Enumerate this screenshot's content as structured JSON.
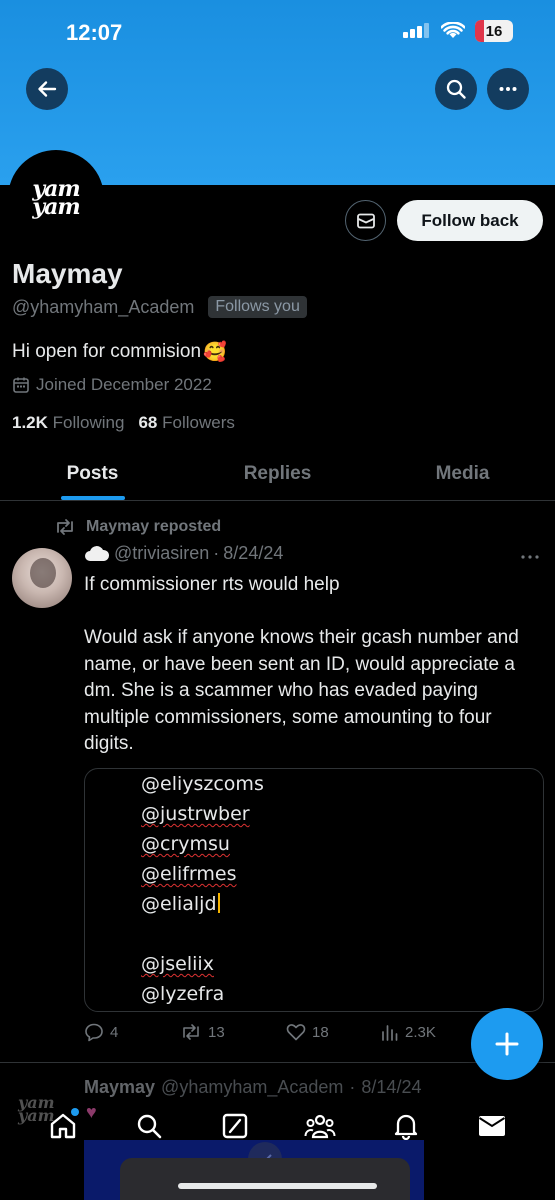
{
  "status_bar": {
    "time": "12:07",
    "battery": "16"
  },
  "profile": {
    "logo_text": "yam yam",
    "message_button_icon": "envelope-icon",
    "follow_label": "Follow back",
    "name": "Maymay",
    "handle": "@yhamyham_Academ",
    "follows_you": "Follows you",
    "bio": "Hi open for commision",
    "bio_emoji": "🥰",
    "joined": "Joined December 2022",
    "following_count": "1.2K",
    "following_label": "Following",
    "followers_count": "68",
    "followers_label": "Followers"
  },
  "tabs": [
    {
      "label": "Posts",
      "active": true
    },
    {
      "label": "Replies",
      "active": false
    },
    {
      "label": "Media",
      "active": false
    }
  ],
  "post": {
    "repost_label": "Maymay reposted",
    "author_handle": "@triviasiren",
    "date": "8/24/24",
    "text": "If commissioner rts would help\n\nWould ask if anyone knows their gcash number and name, or have been sent an ID, would appreciate a dm. She is a scammer who has evaded paying multiple commissioners, some amounting to four digits.",
    "media_lines": [
      "@eliyszcoms",
      "@justrwber",
      "@crymsu",
      "@elifrmes",
      "@elialjd",
      "",
      "@jseliix",
      "@lyzefra"
    ],
    "stats": {
      "replies": "4",
      "reposts": "13",
      "likes": "18",
      "views": "2.3K"
    }
  },
  "next_post": {
    "name": "Maymay",
    "handle": "@yhamyham_Academ",
    "date": "8/14/24"
  },
  "colors": {
    "accent": "#1d9bf0",
    "banner": "#2aa0ee",
    "muted": "#71767b",
    "text": "#e7e9ea"
  }
}
